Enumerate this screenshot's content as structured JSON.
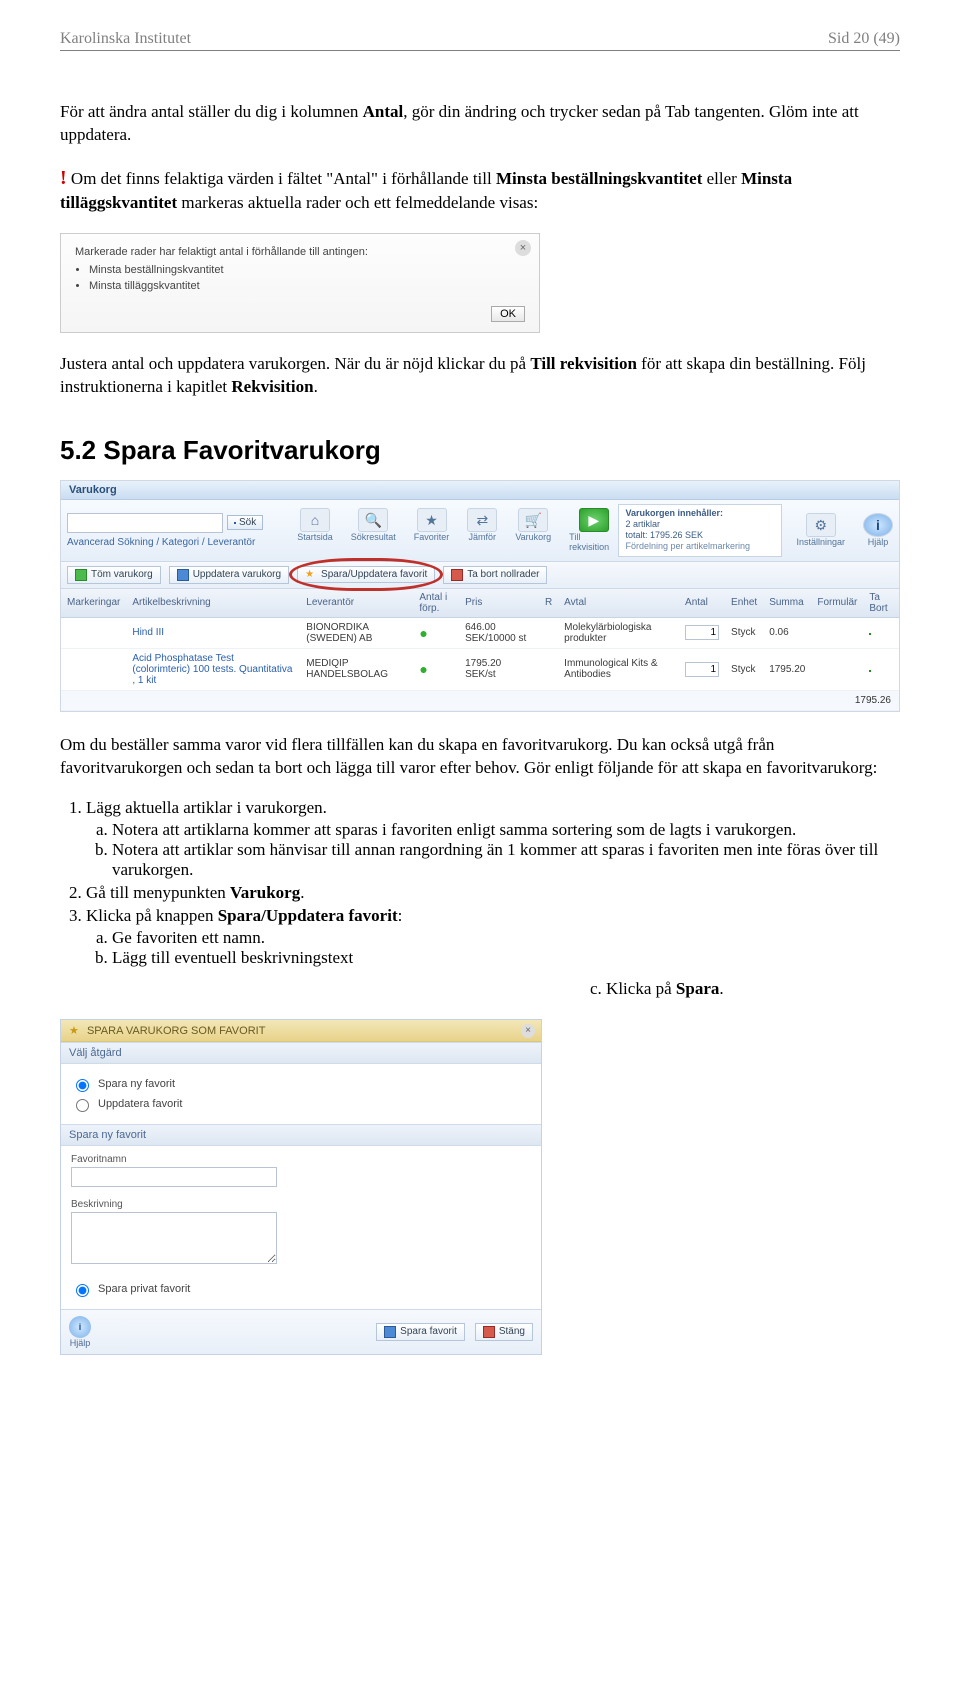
{
  "header": {
    "left": "Karolinska Institutet",
    "right": "Sid 20 (49)"
  },
  "p1_a": "För att ändra antal ställer du dig i kolumnen ",
  "p1_b": "Antal",
  "p1_c": ", gör din ändring och trycker sedan på Tab tangenten. Glöm inte att uppdatera.",
  "bang": "!",
  "p2_a": " Om det finns felaktiga värden i fältet \"Antal\" i förhållande till ",
  "p2_b": "Minsta beställningskvantitet",
  "p2_c": " eller ",
  "p2_d": "Minsta tilläggskvantitet",
  "p2_e": " markeras aktuella rader och ett felmeddelande visas:",
  "dlg": {
    "msg": "Markerade rader har felaktigt antal i förhållande till antingen:",
    "b1": "Minsta beställningskvantitet",
    "b2": "Minsta tilläggskvantitet",
    "ok": "OK"
  },
  "p3_a": "Justera antal och uppdatera varukorgen. När du är nöjd klickar du på ",
  "p3_b": "Till rekvisition",
  "p3_c": " för att skapa din beställning. Följ instruktionerna i kapitlet ",
  "p3_d": "Rekvisition",
  "p3_e": ".",
  "h2": "5.2  Spara Favoritvarukorg",
  "app": {
    "title": "Varukorg",
    "sok": "Sök",
    "crumbs": [
      "Avancerad Sökning",
      "Kategori",
      "Leverantör"
    ],
    "nav": {
      "start": "Startsida",
      "sokres": "Sökresultat",
      "fav": "Favoriter",
      "jamfor": "Jämför",
      "varukorg": "Varukorg",
      "tillrek": "Till rekvisition",
      "inst": "Inställningar",
      "hjalp": "Hjälp"
    },
    "info_title": "Varukorgen innehåller:",
    "info_l1": "2 artiklar",
    "info_l2": "totalt: 1795.26 SEK",
    "info_l3": "Fördelning per artikelmarkering",
    "tb": {
      "tom": "Töm varukorg",
      "upd": "Uppdatera varukorg",
      "favbtn": "Spara/Uppdatera favorit",
      "tabort": "Ta bort nollrader"
    },
    "cols": {
      "mark": "Markeringar",
      "art": "Artikelbeskrivning",
      "lev": "Leverantör",
      "antf": "Antal i förp.",
      "pris": "Pris",
      "r": "R",
      "avtal": "Avtal",
      "antal": "Antal",
      "enhet": "Enhet",
      "summa": "Summa",
      "form": "Formulär",
      "tab": "Ta Bort"
    },
    "rows": [
      {
        "art": "Hind III",
        "lev": "BIONORDIKA (SWEDEN) AB",
        "pris": "646.00 SEK/10000 st",
        "avtal": "Molekylärbiologiska produkter",
        "antal": "1",
        "enhet": "Styck",
        "summa": "0.06"
      },
      {
        "art": "Acid Phosphatase Test (colorimteric) 100 tests. Quantitativa , 1 kit",
        "lev": "MEDIQIP HANDELSBOLAG",
        "pris": "1795.20 SEK/st",
        "avtal": "Immunological Kits & Antibodies",
        "antal": "1",
        "enhet": "Styck",
        "summa": "1795.20"
      }
    ],
    "total": "1795.26"
  },
  "p4": "Om du beställer samma varor vid flera tillfällen kan du skapa en favoritvarukorg. Du kan också utgå från favoritvarukorgen och sedan ta bort och lägga till varor efter behov. Gör enligt följande för att skapa en favoritvarukorg:",
  "ol1_1": "Lägg aktuella artiklar i varukorgen.",
  "ol1_1a": "Notera att artiklarna kommer att sparas i favoriten enligt samma sortering som de lagts i varukorgen.",
  "ol1_1b": "Notera att artiklar som hänvisar till annan rangordning än 1 kommer att sparas i favoriten men inte föras över till varukorgen.",
  "ol1_2a": "Gå till menypunkten ",
  "ol1_2b": "Varukorg",
  "ol1_2c": ".",
  "ol1_3a": "Klicka på knappen ",
  "ol1_3b": "Spara/Uppdatera favorit",
  "ol1_3c": ":",
  "ol1_3_a": " Ge favoriten ett namn.",
  "ol1_3_b": " Lägg till eventuell beskrivningstext",
  "p_c": "c. Klicka på ",
  "p_c_b": "Spara",
  "p_c_c": ".",
  "fav": {
    "title": "SPARA VARUKORG SOM FAVORIT",
    "valj": "Välj åtgärd",
    "r1": "Spara ny favorit",
    "r2": "Uppdatera favorit",
    "sec": "Spara ny favorit",
    "l_name": "Favoritnamn",
    "l_desc": "Beskrivning",
    "priv": "Spara privat favorit",
    "hjalp": "Hjälp",
    "save": "Spara favorit",
    "close": "Stäng"
  }
}
